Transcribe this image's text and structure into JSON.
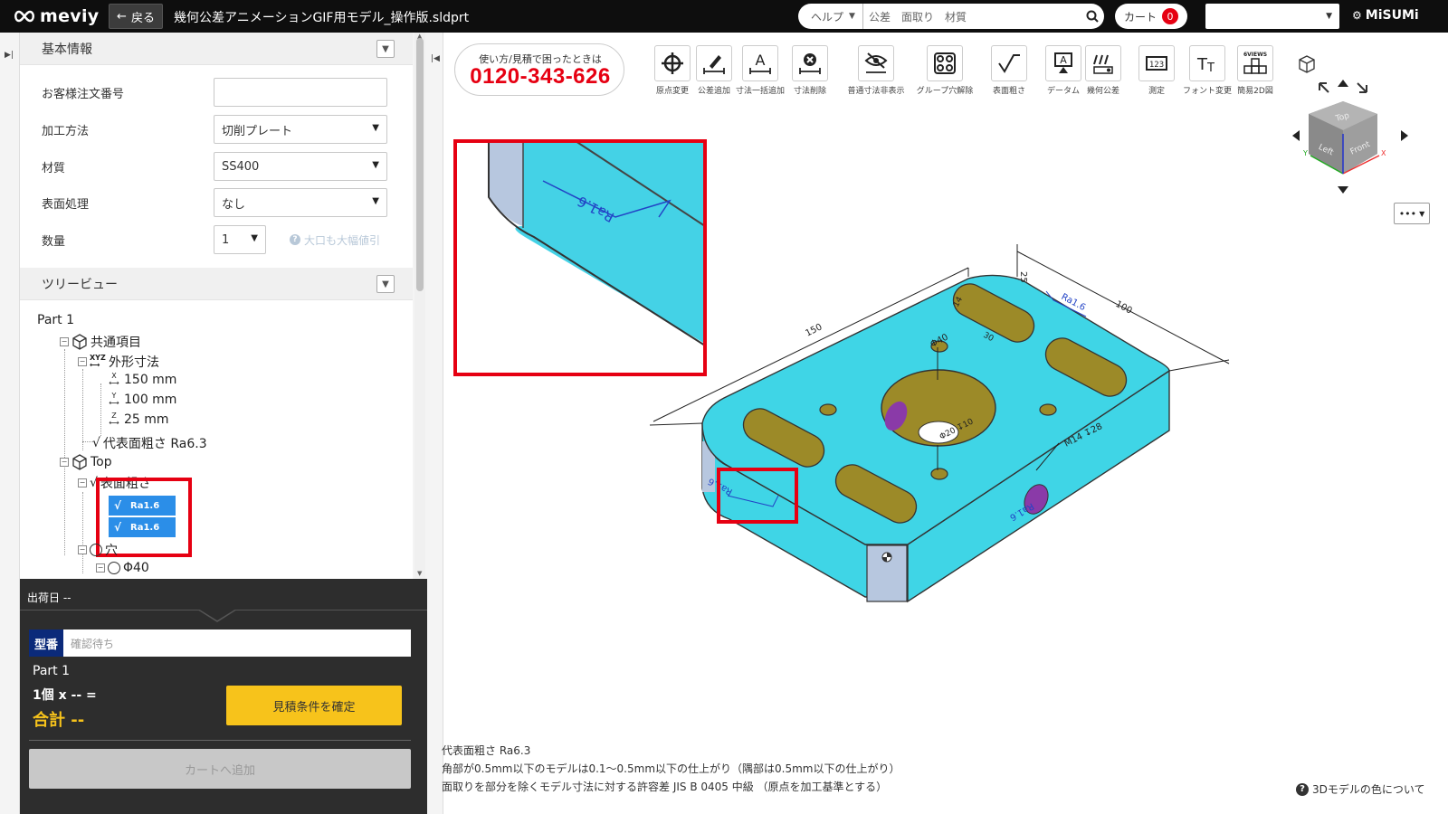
{
  "header": {
    "logo_text": "meviy",
    "back_label": "戻る",
    "file_name": "幾何公差アニメーションGIF用モデル_操作版.sldprt",
    "help_label": "ヘルプ",
    "search_placeholder": "公差　面取り　材質",
    "cart_label": "カート",
    "cart_count": "0",
    "brand": "MiSUMi"
  },
  "left_panel": {
    "basic_info_title": "基本情報",
    "fields": [
      {
        "label": "お客様注文番号",
        "value": ""
      },
      {
        "label": "加工方法",
        "value": "切削プレート"
      },
      {
        "label": "材質",
        "value": "SS400"
      },
      {
        "label": "表面処理",
        "value": "なし"
      },
      {
        "label": "数量",
        "value": "1"
      }
    ],
    "qty_note": "大口も大幅値引",
    "tree_title": "ツリービュー",
    "tree": {
      "part": "Part 1",
      "common": "共通項目",
      "outer_dims": "外形寸法",
      "x": "150 mm",
      "y": "100 mm",
      "z": "25 mm",
      "rep_roughness": "代表面粗さ Ra6.3",
      "top": "Top",
      "roughness": "表面粗さ",
      "ra1": "Ra1.6",
      "ra2": "Ra1.6",
      "hole": "穴",
      "hole_sub": "Φ40"
    }
  },
  "order": {
    "ship_date": "出荷日 --",
    "model_label": "型番",
    "model_value": "確認待ち",
    "part_name": "Part 1",
    "qty_line": "1個  x -- =",
    "total": "合計 --",
    "confirm_label": "見積条件を確定",
    "cart_add_label": "カートへ追加"
  },
  "viewer": {
    "phone_caption": "使い方/見積で困ったときは",
    "phone_number": "0120-343-626",
    "tools": [
      "原点変更",
      "公差追加",
      "寸法一括追加",
      "寸法削除",
      "普通寸法非表示",
      "グループ穴解除",
      "表面粗さ",
      "データム",
      "幾何公差",
      "測定",
      "フォント変更",
      "簡易2D図"
    ],
    "sixviews": "6VIEWS",
    "more_label": "•••",
    "cube_faces": {
      "top": "Top",
      "left": "Left",
      "front": "Front"
    },
    "notes": [
      "代表面粗さ Ra6.3",
      "角部が0.5mm以下のモデルは0.1～0.5mm以下の仕上がり（隅部は0.5mm以下の仕上がり）",
      "面取りを部分を除くモデル寸法に対する許容差 JIS B 0405 中級 （原点を加工基準とする）"
    ],
    "color_help": "3Dモデルの色について",
    "dims": {
      "length": "150",
      "width": "100",
      "height": "25",
      "ra_top": "Ra1.6",
      "ra_side": "Ra1.6",
      "ra_zoom": "Ra1.6",
      "ra_right": "Ra1.6",
      "center_hole": "Φ40",
      "center_note": "Φ20 ↧10",
      "thread": "M14 ↧28",
      "slot_w": "14",
      "slot_l": "30"
    }
  },
  "colors": {
    "model_face": "#3fd5e6",
    "hole_fill": "#9c8a28",
    "purple": "#8a3aa8",
    "highlight": "#e60012",
    "accent_blue": "#2b8ee8",
    "cta_yellow": "#f7c31b"
  }
}
